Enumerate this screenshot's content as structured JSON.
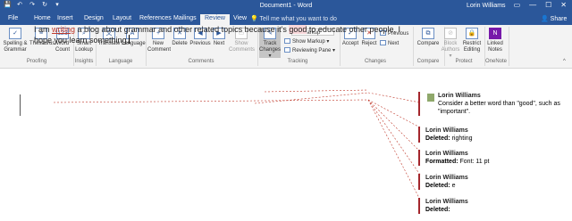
{
  "titlebar": {
    "qat": [
      "💾",
      "↶",
      "↷",
      "↻",
      "▾"
    ],
    "doc_title": "Document1 - Word",
    "user": "Lorin Williams",
    "win": [
      "▭",
      "—",
      "☐",
      "✕"
    ]
  },
  "tabs": [
    "File",
    "Home",
    "Insert",
    "Design",
    "Layout",
    "References",
    "Mailings",
    "Review",
    "View"
  ],
  "active_tab": "Review",
  "tellme": "Tell me what you want to do",
  "share": "Share",
  "ribbon": {
    "proofing": {
      "spelling": "Spelling &",
      "grammar": "Grammar",
      "thesaurus": "Thesaurus",
      "word": "Word",
      "count": "Count",
      "label": "Proofing"
    },
    "insights": {
      "smart": "Smart",
      "lookup": "Lookup",
      "label": "Insights"
    },
    "language": {
      "translate": "Translate",
      "language": "Language",
      "label": "Language"
    },
    "comments": {
      "new": "New",
      "comment": "Comment",
      "delete": "Delete",
      "previous": "Previous",
      "next": "Next",
      "show": "Show",
      "comments": "Comments",
      "label": "Comments"
    },
    "tracking": {
      "track": "Track",
      "changes": "Changes ▾",
      "markup_select": "All Markup",
      "show_markup": "Show Markup ▾",
      "reviewing_pane": "Reviewing Pane ▾",
      "label": "Tracking"
    },
    "changes": {
      "accept": "Accept",
      "reject": "Reject",
      "previous": "Previous",
      "next": "Next",
      "label": "Changes"
    },
    "compare": {
      "compare": "Compare",
      "label": "Compare"
    },
    "protect": {
      "block": "Block",
      "authors": "Authors ▾",
      "restrict": "Restrict",
      "editing": "Editing",
      "label": "Protect"
    },
    "onenote": {
      "linked": "Linked",
      "notes": "Notes",
      "label": "OneNote"
    }
  },
  "document": {
    "t1": "I am ",
    "ins1": "writing",
    "t2": " a blog about grammar and other related topics because it's ",
    "hl": "good",
    "t3": " to educate other people, I hope you learn something."
  },
  "comments": [
    {
      "author": "Lorin Williams",
      "text": "Consider a better word than \"good\", such as \"important\"."
    },
    {
      "author": "Lorin Williams",
      "label": "Deleted:",
      "text": "righting"
    },
    {
      "author": "Lorin Williams",
      "label": "Formatted:",
      "text": "Font: 11 pt"
    },
    {
      "author": "Lorin Williams",
      "label": "Deleted:",
      "text": "e"
    },
    {
      "author": "Lorin Williams",
      "label": "Deleted:",
      "text": ""
    }
  ],
  "colors": {
    "brand": "#2b579a",
    "revision": "#a4262c",
    "insert": "#c0392b"
  }
}
